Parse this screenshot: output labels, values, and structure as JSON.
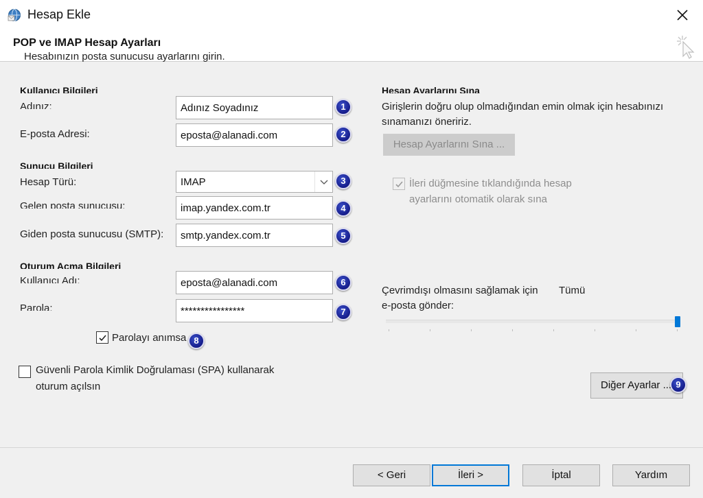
{
  "window": {
    "title": "Hesap Ekle"
  },
  "header": {
    "title": "POP ve IMAP Hesap Ayarları",
    "subtitle": "Hesabınızın posta sunucusu ayarlarını girin."
  },
  "user_info": {
    "section": "Kullanıcı Bilgileri",
    "name_label": "Adınız:",
    "name_value": "Adınız Soyadınız",
    "email_label": "E-posta Adresi:",
    "email_value": "eposta@alanadi.com"
  },
  "server_info": {
    "section": "Sunucu Bilgileri",
    "type_label": "Hesap Türü:",
    "type_value": "IMAP",
    "incoming_label": "Gelen posta sunucusu:",
    "incoming_value": "imap.yandex.com.tr",
    "outgoing_label": "Giden posta sunucusu (SMTP):",
    "outgoing_value": "smtp.yandex.com.tr"
  },
  "logon_info": {
    "section": "Oturum Açma Bilgileri",
    "username_label": "Kullanıcı Adı:",
    "username_value": "eposta@alanadi.com",
    "password_label": "Parola:",
    "password_value": "****************",
    "remember_label": "Parolayı anımsa",
    "remember_checked": true,
    "spa_label_line1": "Güvenli Parola Kimlik Doğrulaması (SPA) kullanarak",
    "spa_label_line2": "oturum açılsın",
    "spa_checked": false
  },
  "test_settings": {
    "section": "Hesap Ayarlarını Sına",
    "desc_line1": "Girişlerin doğru olup olmadığından emin olmak için hesabınızı",
    "desc_line2": "sınamanızı öneririz.",
    "test_button": "Hesap Ayarlarını Sına ...",
    "auto_test_line1": "İleri düğmesine tıklandığında hesap",
    "auto_test_line2": "ayarlarını otomatik olarak sına",
    "auto_test_checked": true
  },
  "offline": {
    "label_line1": "Çevrimdışı olmasını sağlamak için",
    "label_line2": "e-posta gönder:",
    "value": "Tümü",
    "slider_fraction": 1.0
  },
  "more_settings_button": "Diğer Ayarlar ...",
  "badges": [
    "1",
    "2",
    "3",
    "4",
    "5",
    "6",
    "7",
    "8",
    "9"
  ],
  "footer": {
    "back": "< Geri",
    "next": "İleri >",
    "cancel": "İptal",
    "help": "Yardım"
  },
  "colors": {
    "accent": "#0078d7",
    "badge": "#1a238f"
  }
}
